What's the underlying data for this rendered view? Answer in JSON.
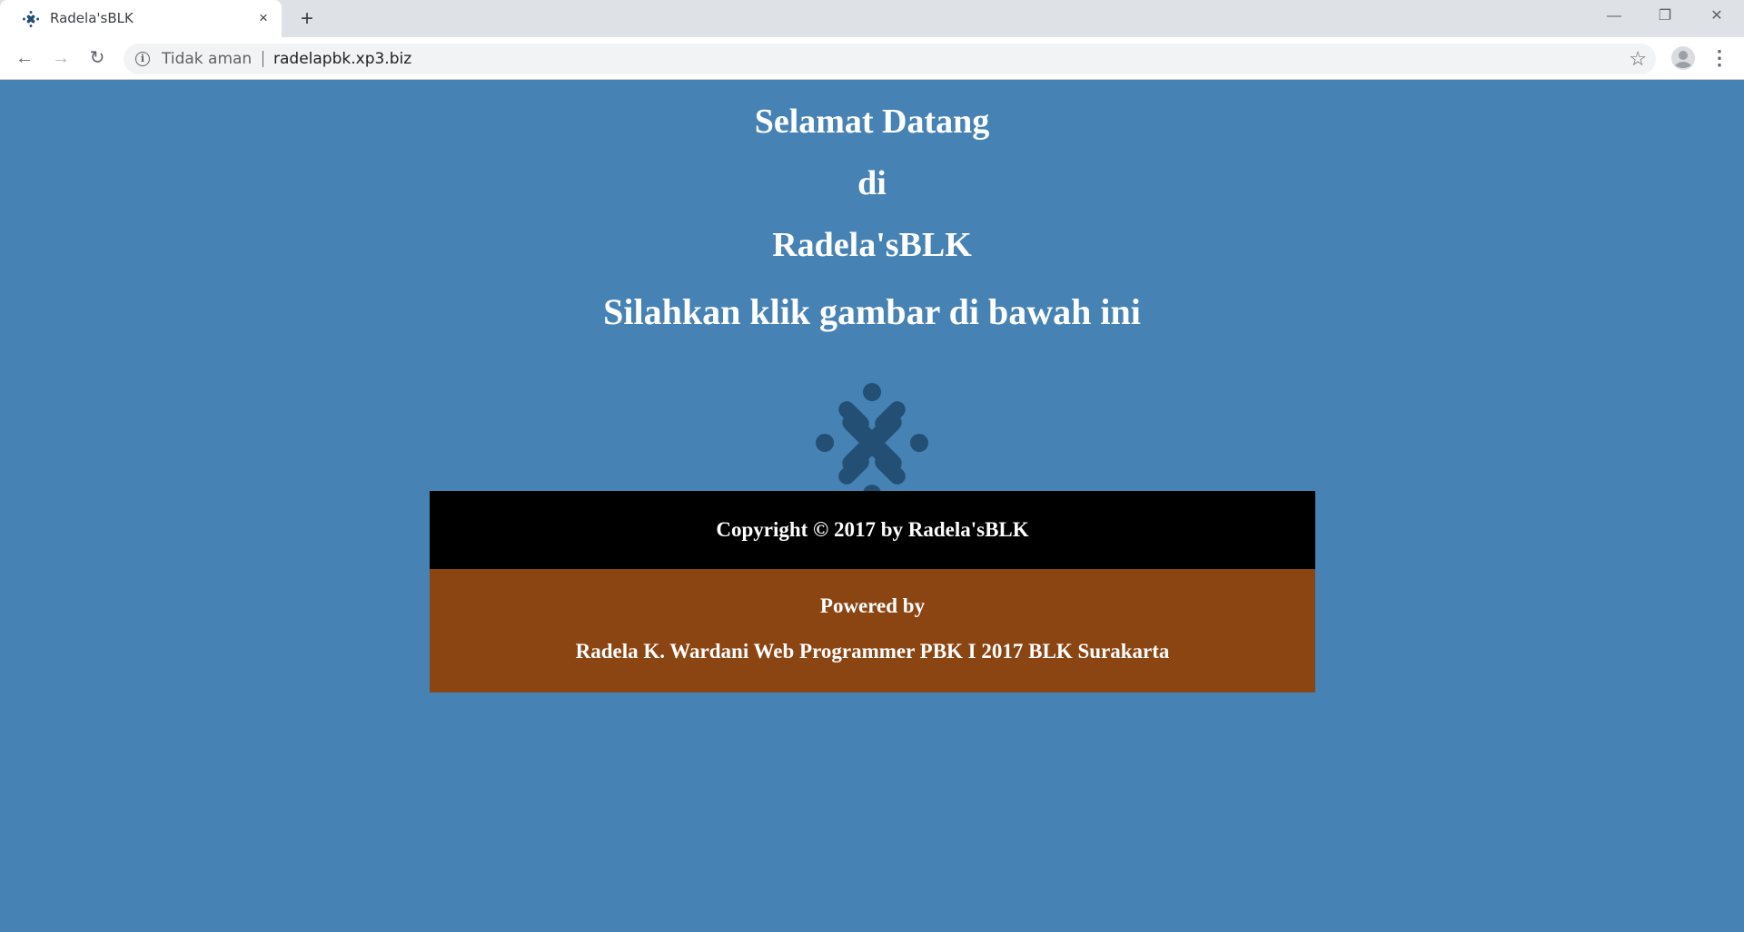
{
  "browser": {
    "tab_title": "Radela'sBLK",
    "tab_close": "×",
    "new_tab": "+",
    "security_text": "Tidak aman",
    "url": "radelapbk.xp3.biz",
    "window_controls": {
      "minimize": "—",
      "restore": "❐",
      "close": "✕"
    },
    "icons": [
      "back-arrow-icon",
      "forward-arrow-icon",
      "reload-icon",
      "info-icon",
      "star-icon",
      "profile-icon",
      "menu-icon"
    ]
  },
  "page": {
    "background": "#4682b4",
    "heading_lines": [
      "Selamat Datang",
      "di",
      "Radela'sBLK",
      "Silahkan klik gambar di bawah ini"
    ],
    "logo_color": "#234f74",
    "copyright": "Copyright © 2017 by Radela'sBLK",
    "powered_by": "Powered by",
    "credits": "Radela K. Wardani Web Programmer PBK I 2017 BLK Surakarta",
    "footer_colors": {
      "copyright_bg": "#000000",
      "credits_bg": "#8b4513"
    }
  }
}
